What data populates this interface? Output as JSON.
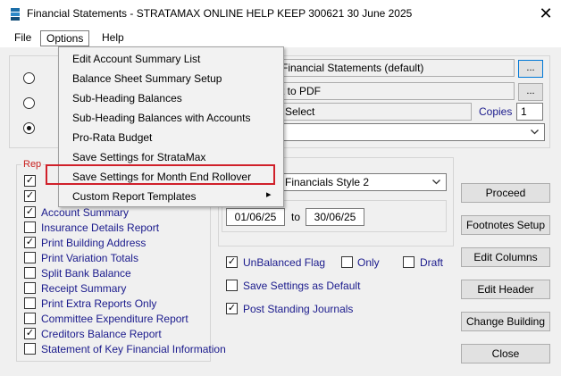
{
  "window": {
    "title": "Financial Statements - STRATAMAX ONLINE HELP KEEP 300621 30 June 2025",
    "close_glyph": "✕"
  },
  "menubar": {
    "items": [
      "File",
      "Options",
      "Help"
    ]
  },
  "options_menu": {
    "items": [
      "Edit Account Summary List",
      "Balance Sheet Summary Setup",
      "Sub-Heading Balances",
      "Sub-Heading Balances with Accounts",
      "Pro-Rata Budget",
      "Save Settings for StrataMax",
      "Save Settings for Month End Rollover",
      "Custom Report Templates"
    ],
    "submenu_arrow": "▸",
    "highlight_color": "#d0202a"
  },
  "output": {
    "printer_value": "Financial Statements (default)",
    "pdf_value": "t to PDF",
    "select_value": "Select",
    "copies_label": "Copies",
    "copies_value": "1",
    "browse_label": "..."
  },
  "reports": {
    "group_label": "Rep",
    "items": [
      {
        "label": "Account Summary",
        "checked": true
      },
      {
        "label": "Insurance Details Report",
        "checked": false
      },
      {
        "label": "Print Building Address",
        "checked": true
      },
      {
        "label": "Print Variation Totals",
        "checked": false
      },
      {
        "label": "Split Bank Balance",
        "checked": false
      },
      {
        "label": "Receipt Summary",
        "checked": false
      },
      {
        "label": "Print Extra Reports Only",
        "checked": false
      },
      {
        "label": "Committee Expenditure Report",
        "checked": false
      },
      {
        "label": "Creditors Balance Report",
        "checked": true
      },
      {
        "label": "Statement of Key Financial Information",
        "checked": false
      }
    ]
  },
  "style": {
    "selected": "Financials Style 2"
  },
  "dates": {
    "from": "01/06/25",
    "to_label": "to",
    "to": "30/06/25"
  },
  "options": {
    "unbalanced_flag": "UnBalanced Flag",
    "only": "Only",
    "draft": "Draft",
    "save_default": "Save Settings as Default",
    "post_standing": "Post Standing Journals"
  },
  "buttons": {
    "proceed": "Proceed",
    "footnotes": "Footnotes Setup",
    "edit_columns": "Edit Columns",
    "edit_header": "Edit Header",
    "change_building": "Change Building",
    "close": "Close"
  }
}
